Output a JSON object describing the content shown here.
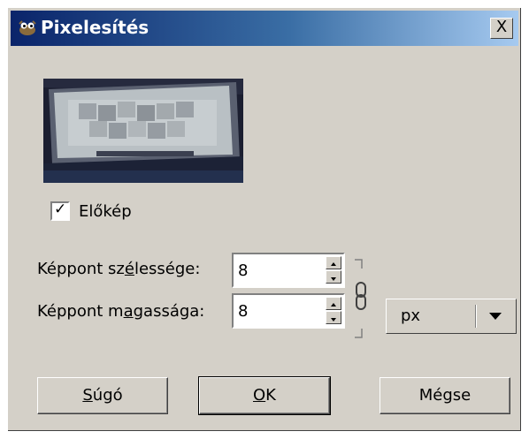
{
  "window": {
    "title": "Pixelesítés",
    "close_label": "X"
  },
  "preview_toggle": {
    "label": "Előkép",
    "checked": true
  },
  "width_field": {
    "label_pre": "Képpont sz",
    "label_mnemonic": "é",
    "label_post": "lessége:",
    "value": "8"
  },
  "height_field": {
    "label_pre": "Képpont m",
    "label_mnemonic": "a",
    "label_post": "gassága:",
    "value": "8"
  },
  "unit": {
    "value": "px"
  },
  "buttons": {
    "help": {
      "mnemonic": "S",
      "rest": "úgó"
    },
    "ok": {
      "mnemonic": "O",
      "rest": "K"
    },
    "cancel": {
      "label": "Mégse"
    }
  },
  "icons": {
    "app": "gimp-wilber-icon",
    "chain": "chain-link-icon",
    "dropdown": "triangle-down-icon"
  }
}
